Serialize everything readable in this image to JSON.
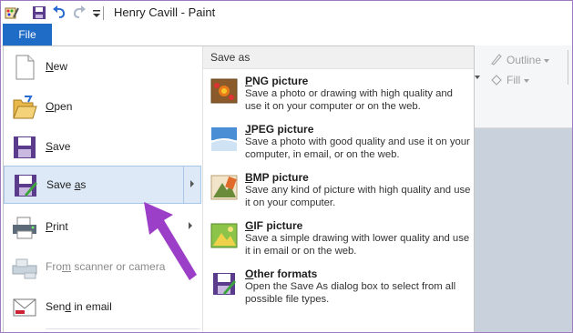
{
  "window": {
    "title": "Henry Cavill - Paint"
  },
  "ribbon": {
    "file_tab": "File",
    "outline_label": "Outline",
    "fill_label": "Fill"
  },
  "file_menu": {
    "items": [
      {
        "label": "New",
        "underline": "N",
        "rest": "ew"
      },
      {
        "label": "Open",
        "underline": "O",
        "rest": "pen"
      },
      {
        "label": "Save",
        "underline": "S",
        "rest": "ave"
      },
      {
        "label": "Save as",
        "before": "Save ",
        "underline": "a",
        "rest": "s"
      },
      {
        "label": "Print",
        "underline": "P",
        "rest": "rint"
      },
      {
        "label": "From scanner or camera",
        "before": "Fro",
        "underline": "m",
        "rest": " scanner or camera"
      },
      {
        "label": "Send in email",
        "before": "Sen",
        "underline": "d",
        "rest": " in email"
      }
    ]
  },
  "save_as": {
    "header": "Save as",
    "options": [
      {
        "title_u": "P",
        "title_rest": "NG picture",
        "desc": "Save a photo or drawing with high quality and use it on your computer or on the web."
      },
      {
        "title_u": "J",
        "title_rest": "PEG picture",
        "desc": "Save a photo with good quality and use it on your computer, in email, or on the web."
      },
      {
        "title_u": "B",
        "title_rest": "MP picture",
        "desc": "Save any kind of picture with high quality and use it on your computer."
      },
      {
        "title_u": "G",
        "title_rest": "IF picture",
        "desc": "Save a simple drawing with lower quality and use it in email or on the web."
      },
      {
        "title_u": "O",
        "title_rest": "ther formats",
        "desc": "Open the Save As dialog box to select from all possible file types."
      }
    ]
  },
  "colors": {
    "file_tab": "#1e6cc6",
    "highlight": "#dde9f6",
    "annotation_arrow": "#9b3fc9"
  }
}
